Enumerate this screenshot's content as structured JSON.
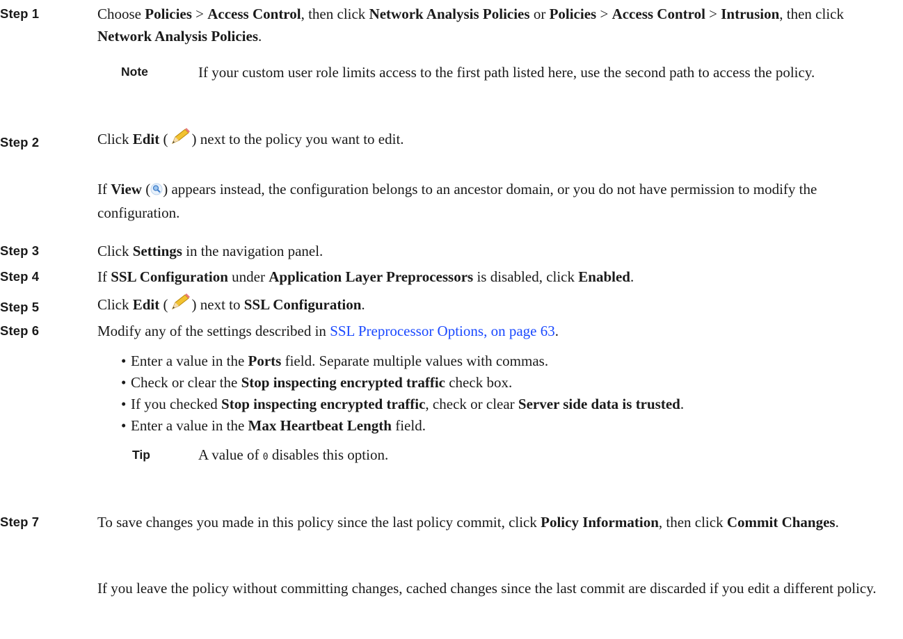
{
  "steps": [
    {
      "label": "Step 1"
    },
    {
      "label": "Step 2"
    },
    {
      "label": "Step 3"
    },
    {
      "label": "Step 4"
    },
    {
      "label": "Step 5"
    },
    {
      "label": "Step 6"
    },
    {
      "label": "Step 7"
    }
  ],
  "step1": {
    "t1": "Choose ",
    "b1": "Policies",
    "t2": " > ",
    "b2": "Access Control",
    "t3": ", then click ",
    "b3": "Network Analysis Policies",
    "t4": " or ",
    "b4": "Policies",
    "t5": "  > ",
    "b5": "Access Control",
    "t6": " > ",
    "b6": "Intrusion",
    "t7": ", then click ",
    "b7": "Network Analysis Policies",
    "t8": "."
  },
  "note": {
    "label": "Note",
    "text": "If your custom user role limits access to the first path listed here, use the second path to access the policy."
  },
  "step2": {
    "t1": "Click ",
    "b1": "Edit",
    "t2": " (",
    "t3": ") next to the policy you want to edit.",
    "view_t1": "If ",
    "view_b1": "View",
    "view_t2": " (",
    "view_t3": ") appears instead, the configuration belongs to an ancestor domain, or you do not have permission to modify the configuration."
  },
  "step3": {
    "t1": "Click ",
    "b1": "Settings",
    "t2": " in the navigation panel."
  },
  "step4": {
    "t1": "If ",
    "b1": "SSL Configuration",
    "t2": " under ",
    "b2": "Application Layer Preprocessors",
    "t3": " is disabled, click ",
    "b3": "Enabled",
    "t4": "."
  },
  "step5": {
    "t1": "Click ",
    "b1": "Edit",
    "t2": " (",
    "t3": ") next to ",
    "b2": "SSL Configuration",
    "t4": "."
  },
  "step6": {
    "t1": "Modify any of the settings described in ",
    "link": "SSL Preprocessor Options, on page 63",
    "t2": "."
  },
  "bullets": {
    "b1": {
      "t1": "Enter a value in the ",
      "b1": "Ports",
      "t2": " field. Separate multiple values with commas."
    },
    "b2": {
      "t1": "Check or clear the ",
      "b1": "Stop inspecting encrypted traffic",
      "t2": " check box."
    },
    "b3": {
      "t1": "If you checked ",
      "b1": "Stop inspecting encrypted traffic",
      "t2": ", check or clear ",
      "b2": "Server side data is trusted",
      "t3": "."
    },
    "b4": {
      "t1": "Enter a value in the ",
      "b1": "Max Heartbeat Length",
      "t2": " field."
    }
  },
  "bullet_glyph": "•",
  "tip": {
    "label": "Tip",
    "t1": "A value of ",
    "code": "0",
    "t2": " disables this option."
  },
  "step7": {
    "t1": "To save changes you made in this policy since the last policy commit, click ",
    "b1": "Policy Information",
    "t2": ", then click ",
    "b2": "Commit Changes",
    "t3": ".",
    "p2": "If you leave the policy without committing changes, cached changes since the last commit are discarded if you edit a different policy."
  },
  "icons": {
    "edit": "pencil-icon",
    "view": "magnifier-icon"
  },
  "colors": {
    "link": "#1a49ff",
    "text": "#1a1a1a"
  }
}
